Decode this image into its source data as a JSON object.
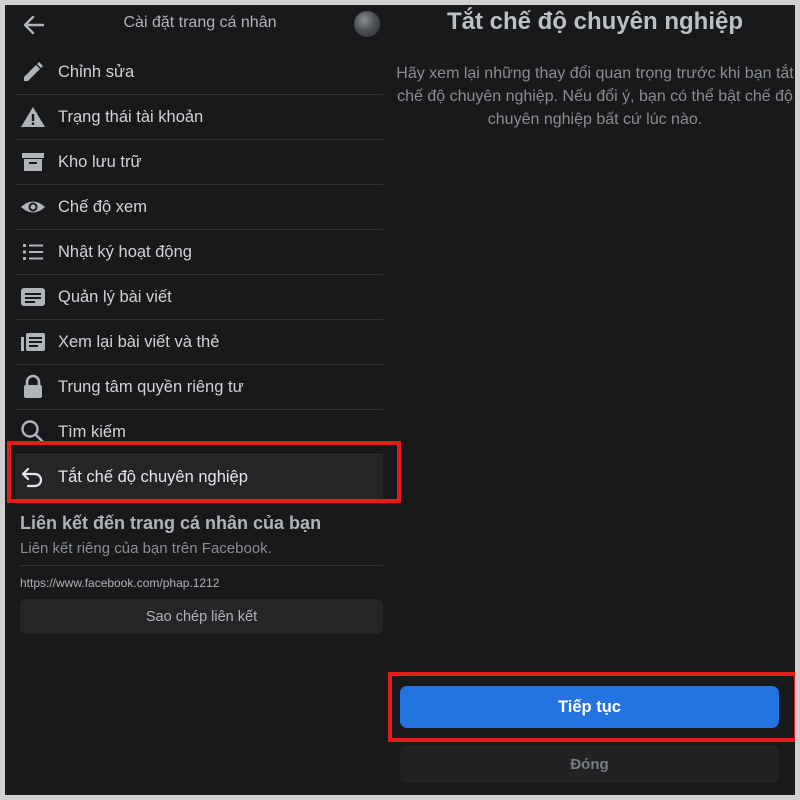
{
  "left_panel": {
    "header": {
      "title": "Cài đặt trang cá nhân",
      "back_icon": "arrow-left-icon",
      "avatar_icon": "avatar"
    },
    "menu": [
      {
        "label": "Chỉnh sửa",
        "icon": "pencil-icon"
      },
      {
        "label": "Trạng thái tài khoản",
        "icon": "warning-icon"
      },
      {
        "label": "Kho lưu trữ",
        "icon": "archive-icon"
      },
      {
        "label": "Chế độ xem",
        "icon": "eye-icon"
      },
      {
        "label": "Nhật ký hoạt động",
        "icon": "list-icon"
      },
      {
        "label": "Quản lý bài viết",
        "icon": "post-icon"
      },
      {
        "label": "Xem lại bài viết và thẻ",
        "icon": "review-icon"
      },
      {
        "label": "Trung tâm quyền riêng tư",
        "icon": "lock-icon"
      },
      {
        "label": "Tìm kiếm",
        "icon": "search-icon"
      },
      {
        "label": "Tắt chế độ chuyên nghiệp",
        "icon": "undo-icon",
        "highlighted": true
      }
    ],
    "profile_link": {
      "title": "Liên kết đến trang cá nhân của bạn",
      "subtitle": "Liên kết riêng của bạn trên Facebook.",
      "url": "https://www.facebook.com/phap.1212",
      "copy_label": "Sao chép liên kết"
    }
  },
  "right_panel": {
    "title": "Tắt chế độ chuyên nghiệp",
    "body": "Hãy xem lại những thay đổi quan trọng trước khi bạn tắt chế độ chuyên nghiệp. Nếu đổi ý, bạn có thể bật chế độ chuyên nghiệp bất cứ lúc nào.",
    "continue_label": "Tiếp tục",
    "close_label": "Đóng"
  },
  "colors": {
    "background": "#18191a",
    "text_primary": "#d0d2d6",
    "text_secondary": "#8a8d91",
    "accent_blue": "#2374e1",
    "highlight_red": "#e41b1b"
  }
}
